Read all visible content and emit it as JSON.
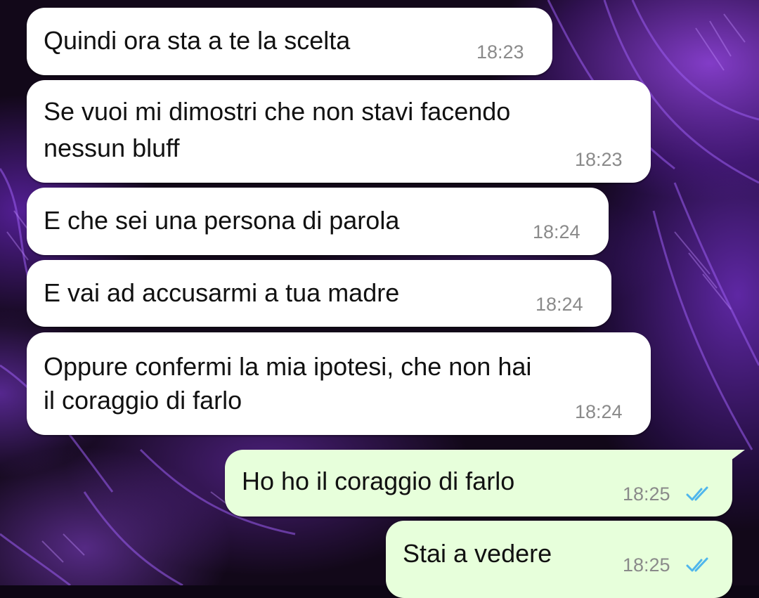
{
  "chat": {
    "messages": [
      {
        "direction": "incoming",
        "lines": [
          "Quindi ora sta a te la scelta"
        ],
        "time": "18:23"
      },
      {
        "direction": "incoming",
        "lines": [
          "Se vuoi mi dimostri che non stavi facendo",
          "nessun bluff"
        ],
        "time": "18:23"
      },
      {
        "direction": "incoming",
        "lines": [
          "E che sei una persona di parola"
        ],
        "time": "18:24"
      },
      {
        "direction": "incoming",
        "lines": [
          "E vai ad accusarmi a tua madre"
        ],
        "time": "18:24"
      },
      {
        "direction": "incoming",
        "lines": [
          "Oppure confermi la mia ipotesi, che non hai",
          "il coraggio di farlo"
        ],
        "time": "18:24"
      },
      {
        "direction": "outgoing",
        "lines": [
          "Ho ho il coraggio di farlo"
        ],
        "time": "18:25",
        "status": "read"
      },
      {
        "direction": "outgoing",
        "lines": [
          "Stai a vedere"
        ],
        "time": "18:25",
        "status": "read"
      }
    ]
  },
  "colors": {
    "incoming_bubble": "#ffffff",
    "outgoing_bubble": "#e7ffdb",
    "text": "#111111",
    "timestamp": "#8a8a8a",
    "read_ticks": "#4fb6ec",
    "wallpaper_accent": "#7b3fd6"
  },
  "icons": {
    "read_status": "double-check-icon"
  }
}
